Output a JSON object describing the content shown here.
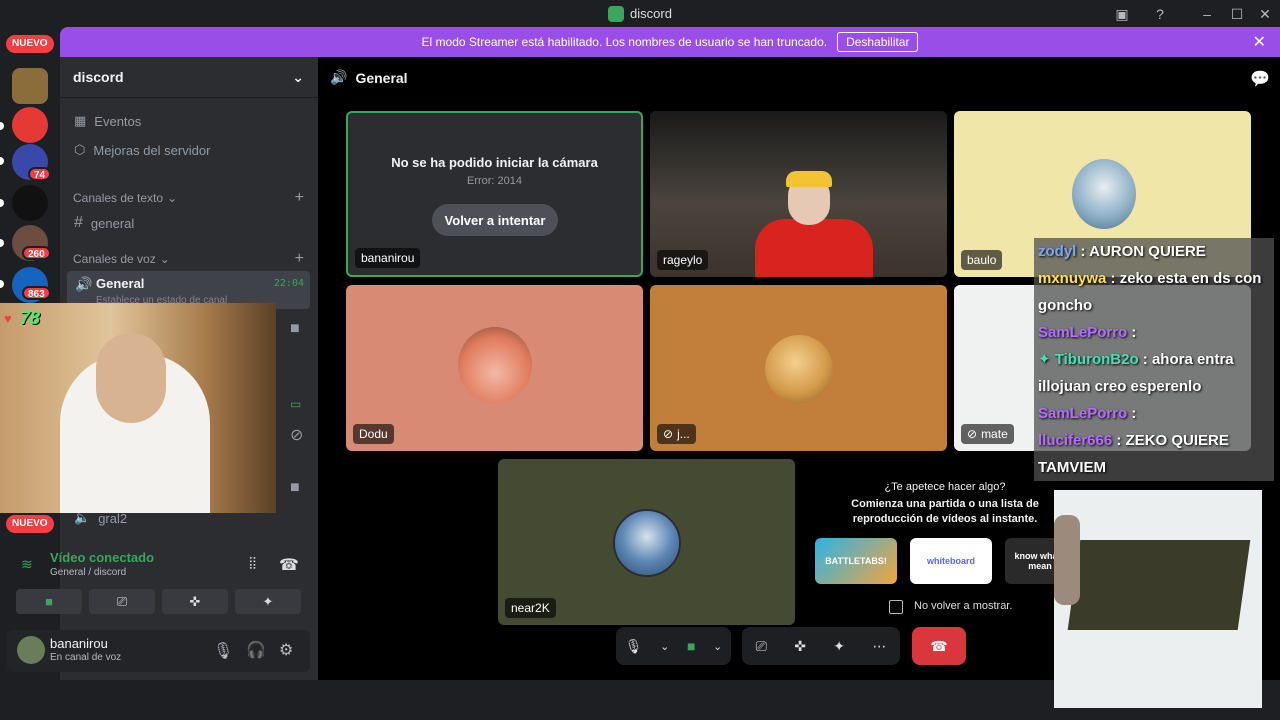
{
  "window": {
    "title": "discord"
  },
  "banner": {
    "text": "El modo Streamer está habilitado. Los nombres de usuario se han truncado.",
    "button_label": "Deshabilitar"
  },
  "rail": {
    "nuevo_label": "NUEVO",
    "badges": [
      "74",
      "260",
      "863"
    ],
    "badge_top": "8"
  },
  "sidebar": {
    "server_name": "discord",
    "items": [
      {
        "label": "Eventos",
        "icon": "calendar-icon"
      },
      {
        "label": "Mejoras del servidor",
        "icon": "boost-icon"
      }
    ],
    "text_category": "Canales de texto",
    "text_channel": "general",
    "voice_category": "Canales de voz",
    "voice_channel": {
      "name": "General",
      "time": "22:04",
      "status": "Establece un estado de canal"
    },
    "voice_channel_2": "gral2"
  },
  "rtc": {
    "status": "Vídeo conectado",
    "route": "General / discord"
  },
  "user": {
    "name": "bananirou",
    "status": "En canal de voz"
  },
  "main": {
    "channel_title": "General",
    "camera_error": {
      "title": "No se ha podido iniciar la cámara",
      "error": "Error: 2014",
      "retry_label": "Volver a intentar"
    },
    "tiles": [
      {
        "name": "bananirou",
        "muted": false
      },
      {
        "name": "rageylo",
        "muted": false
      },
      {
        "name": "baulo",
        "muted": false
      },
      {
        "name": "Dodu",
        "muted": false
      },
      {
        "name": "j...",
        "muted": true
      },
      {
        "name": "mate",
        "muted": true
      },
      {
        "name": "near2K",
        "muted": false
      }
    ],
    "activity": {
      "title": "¿Te apetece hacer algo?",
      "subtitle": "Comienza una partida o una lista de reproducción de vídeos al instante.",
      "cards": [
        "BATTLETABS!",
        "whiteboard",
        "know what i mean"
      ],
      "checkbox_label": "No volver a mostrar."
    }
  },
  "chat": [
    {
      "user": "zodyl",
      "msg": " : AURON QUIERE",
      "cls": "u1"
    },
    {
      "user": "mxnuywa",
      "msg": " : zeko esta en ds con goncho",
      "cls": "u2"
    },
    {
      "user": "SamLePorro",
      "msg": " : ",
      "cls": "u3"
    },
    {
      "user": "✦ TiburonB2o",
      "msg": " : ahora entra illojuan creo esperenlo",
      "cls": "u4"
    },
    {
      "user": "SamLePorro",
      "msg": " : ",
      "cls": "u3"
    },
    {
      "user": "llucifer666",
      "msg": " : ZEKO QUIERE TAMVIEM",
      "cls": "u3"
    }
  ],
  "overlay": {
    "heart_count": "78"
  },
  "colors": {
    "brand": "#5865f2",
    "green": "#3ba55d",
    "red": "#da373c",
    "streamer": "#9a4ee8"
  }
}
